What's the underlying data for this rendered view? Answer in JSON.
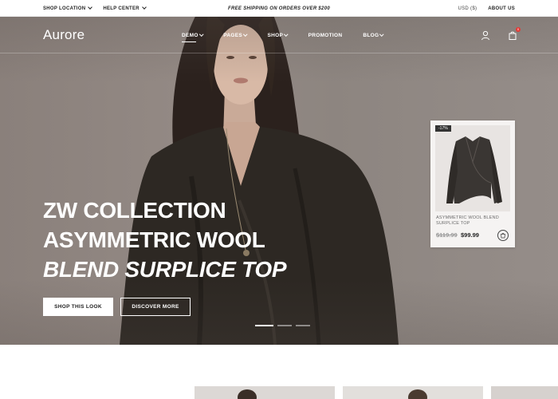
{
  "topbar": {
    "shop_location": "SHOP LOCATION",
    "help_center": "HELP CENTER",
    "announcement": "FREE SHIPPING ON ORDERS OVER $200",
    "currency": "USD ($)",
    "about_us": "ABOUT US"
  },
  "header": {
    "logo": "Aurore",
    "nav": [
      {
        "label": "DEMO"
      },
      {
        "label": "PAGES"
      },
      {
        "label": "SHOP"
      },
      {
        "label": "PROMOTION"
      },
      {
        "label": "BLOG"
      }
    ],
    "cart_count": "0"
  },
  "hero": {
    "line1": "ZW COLLECTION",
    "line2": "ASYMMETRIC WOOL",
    "line3": "BLEND SURPLICE TOP",
    "btn_primary": "SHOP THIS LOOK",
    "btn_secondary": "DISCOVER MORE",
    "slides": 3,
    "active_slide": 1
  },
  "product_card": {
    "discount": "-17%",
    "name": "ASYMMETRIC WOOL BLEND SURPLICE TOP",
    "old_price": "$119.99",
    "new_price": "$99.99"
  }
}
